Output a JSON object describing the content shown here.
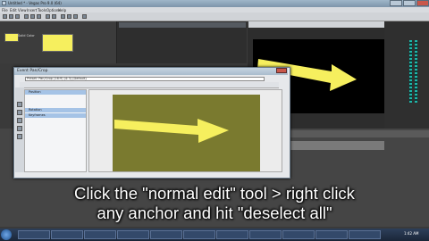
{
  "window": {
    "title": "Untitled * - Vegas Pro 9.0 (64)"
  },
  "menu": [
    "File",
    "Edit",
    "View",
    "Insert",
    "Tools",
    "Options",
    "Help"
  ],
  "dialog": {
    "title": "Event Pan/Crop",
    "preset": "Preset: Pan/Crop (16:9) (4:3) (Default)",
    "rows": [
      "Position",
      "",
      "",
      "Rotation",
      "Keyframes"
    ],
    "selected_rows": [
      0,
      3,
      4
    ]
  },
  "media": {
    "label": "Solid Color"
  },
  "caption": {
    "line1": "Click the \"normal edit\" tool > right click",
    "line2": "any anchor and hit \"deselect all\""
  },
  "taskbar": {
    "tasks": [
      "",
      "",
      "",
      "",
      "",
      "",
      "",
      "",
      "",
      "",
      ""
    ],
    "clock": "1:42 AM"
  },
  "colors": {
    "arrow": "#f6ef5e",
    "olive": "#7a7a2f"
  }
}
